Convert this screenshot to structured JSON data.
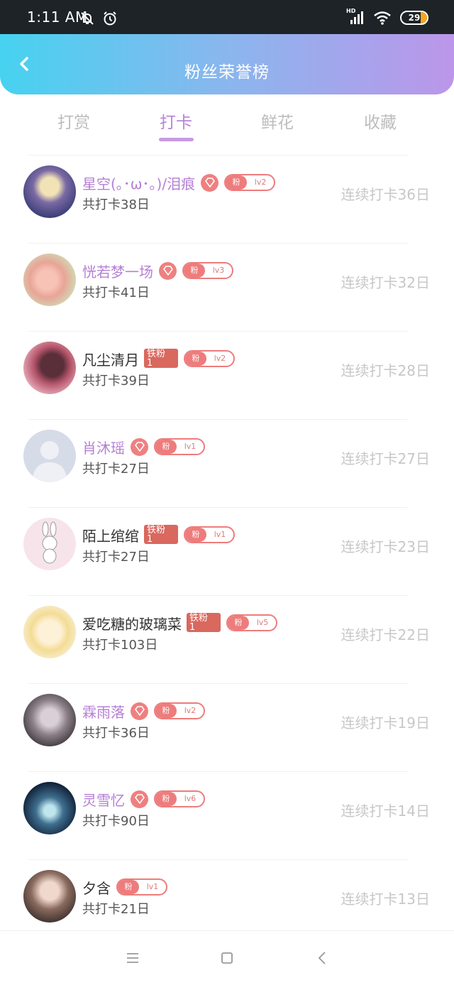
{
  "status_bar": {
    "time": "1:11 AM",
    "network_label": "HD",
    "battery_level": "29",
    "icons": [
      "bell-off-icon",
      "alarm-icon",
      "signal-icon",
      "wifi-icon",
      "battery-icon"
    ]
  },
  "header": {
    "title": "粉丝荣誉榜",
    "back_icon": "chevron-left-icon"
  },
  "tabs": [
    {
      "label": "打赏",
      "active": false
    },
    {
      "label": "打卡",
      "active": true
    },
    {
      "label": "鲜花",
      "active": false
    },
    {
      "label": "收藏",
      "active": false
    }
  ],
  "colors": {
    "accent_purple": "#b784d8",
    "badge_red": "#ee7c7c",
    "tie_badge": "#d9685f",
    "header_gradient_start": "#46d2f0",
    "header_gradient_end": "#bc96ea"
  },
  "fans": [
    {
      "name": "星空(｡･ω･｡)/泪痕",
      "name_color": "purple",
      "diamond": true,
      "tie_badge": "",
      "fan_label": "粉",
      "level": "lv2",
      "total": "共打卡38日",
      "streak": "连续打卡36日"
    },
    {
      "name": "恍若梦一场",
      "name_color": "purple",
      "diamond": true,
      "tie_badge": "",
      "fan_label": "粉",
      "level": "lv3",
      "total": "共打卡41日",
      "streak": "连续打卡32日"
    },
    {
      "name": "凡尘清月",
      "name_color": "black",
      "diamond": false,
      "tie_badge": "铁粉\n1",
      "fan_label": "粉",
      "level": "lv2",
      "total": "共打卡39日",
      "streak": "连续打卡28日"
    },
    {
      "name": "肖沐瑶",
      "name_color": "purple",
      "diamond": true,
      "tie_badge": "",
      "fan_label": "粉",
      "level": "lv1",
      "total": "共打卡27日",
      "streak": "连续打卡27日"
    },
    {
      "name": "陌上绾绾",
      "name_color": "black",
      "diamond": false,
      "tie_badge": "铁粉\n1",
      "fan_label": "粉",
      "level": "lv1",
      "total": "共打卡27日",
      "streak": "连续打卡23日"
    },
    {
      "name": "爱吃糖的玻璃菜",
      "name_color": "black",
      "diamond": false,
      "tie_badge": "铁粉\n1",
      "fan_label": "粉",
      "level": "lv5",
      "total": "共打卡103日",
      "streak": "连续打卡22日"
    },
    {
      "name": "霖雨落",
      "name_color": "purple",
      "diamond": true,
      "tie_badge": "",
      "fan_label": "粉",
      "level": "lv2",
      "total": "共打卡36日",
      "streak": "连续打卡19日"
    },
    {
      "name": "灵雪忆",
      "name_color": "purple",
      "diamond": true,
      "tie_badge": "",
      "fan_label": "粉",
      "level": "lv6",
      "total": "共打卡90日",
      "streak": "连续打卡14日"
    },
    {
      "name": "夕含",
      "name_color": "black",
      "diamond": false,
      "tie_badge": "",
      "fan_label": "粉",
      "level": "lv1",
      "total": "共打卡21日",
      "streak": "连续打卡13日"
    }
  ],
  "bottom_nav": [
    "menu-icon",
    "home-square-icon",
    "back-triangle-icon"
  ]
}
